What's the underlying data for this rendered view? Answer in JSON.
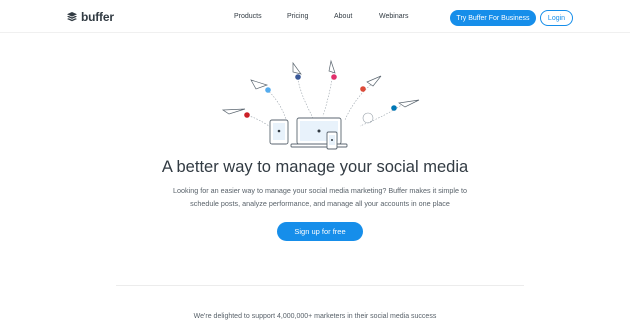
{
  "brand": {
    "name": "buffer",
    "accent": "#168eea"
  },
  "nav": {
    "items": [
      {
        "label": "Products"
      },
      {
        "label": "Pricing"
      },
      {
        "label": "About"
      },
      {
        "label": "Webinars"
      }
    ],
    "cta_label": "Try Buffer For Business",
    "login_label": "Login"
  },
  "hero": {
    "title": "A better way to manage your social media",
    "subtitle_line1": "Looking for an easier way to manage your social media marketing? Buffer makes it simple to",
    "subtitle_line2": "schedule posts, analyze performance, and manage all your accounts in one place",
    "cta_label": "Sign up for free"
  },
  "footer": {
    "note": "We're delighted to support 4,000,000+ marketers in their social media success"
  },
  "icons": {
    "logo": "buffer-stack-icon",
    "illustration": [
      "paper-plane-icon",
      "twitter-icon",
      "facebook-icon",
      "instagram-icon",
      "google-plus-icon",
      "linkedin-icon",
      "pinterest-icon",
      "tablet-icon",
      "laptop-icon",
      "phone-icon"
    ]
  }
}
